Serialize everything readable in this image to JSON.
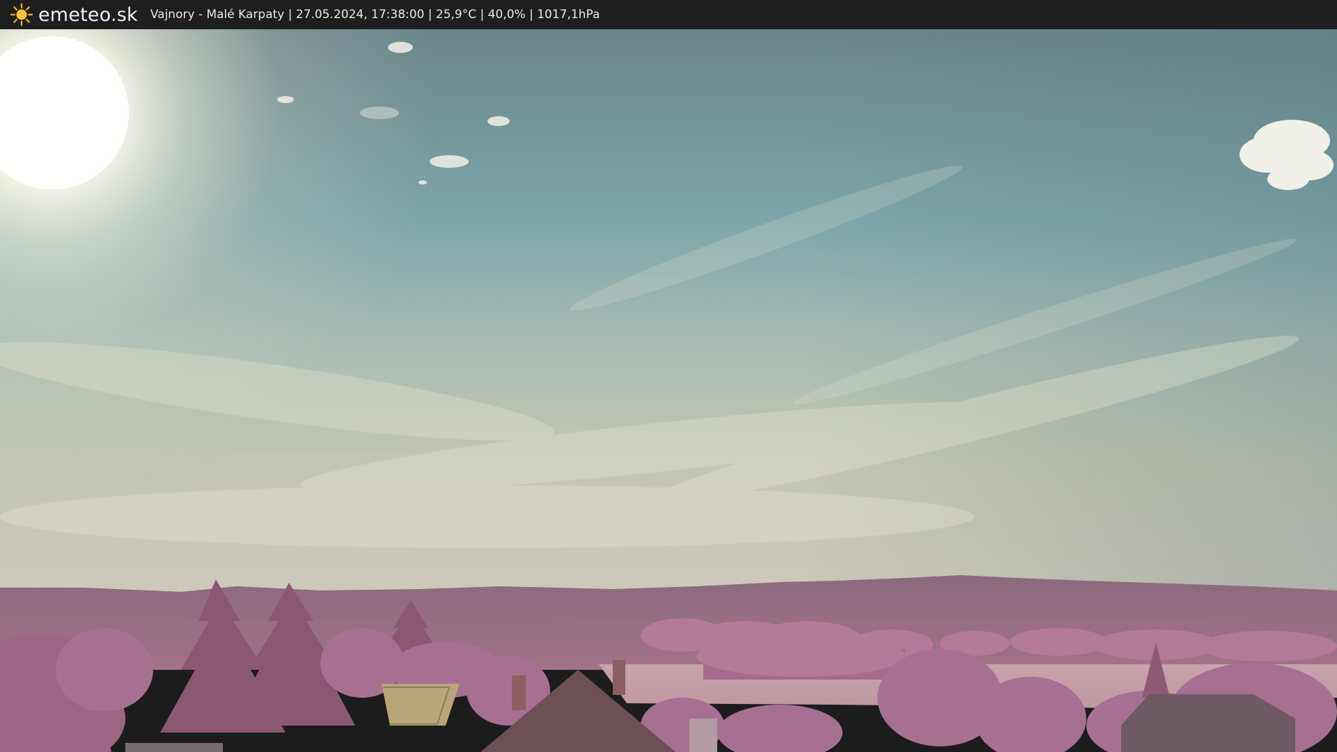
{
  "header": {
    "brand": "emeteo.sk",
    "caption": "Vajnory - Malé Karpaty | 27.05.2024, 17:38:00 | 25,9°C | 40,0% | 1017,1hPa",
    "logo_icon": "sun-icon"
  },
  "colors": {
    "bar": "#1e1e1e",
    "sky_top": "#6f8b91",
    "sky_mid": "#80a9ad",
    "sky_low": "#c5c7b3",
    "hills": "#8a6478",
    "foliage": "#b07996",
    "field": "#c9a7ae"
  }
}
